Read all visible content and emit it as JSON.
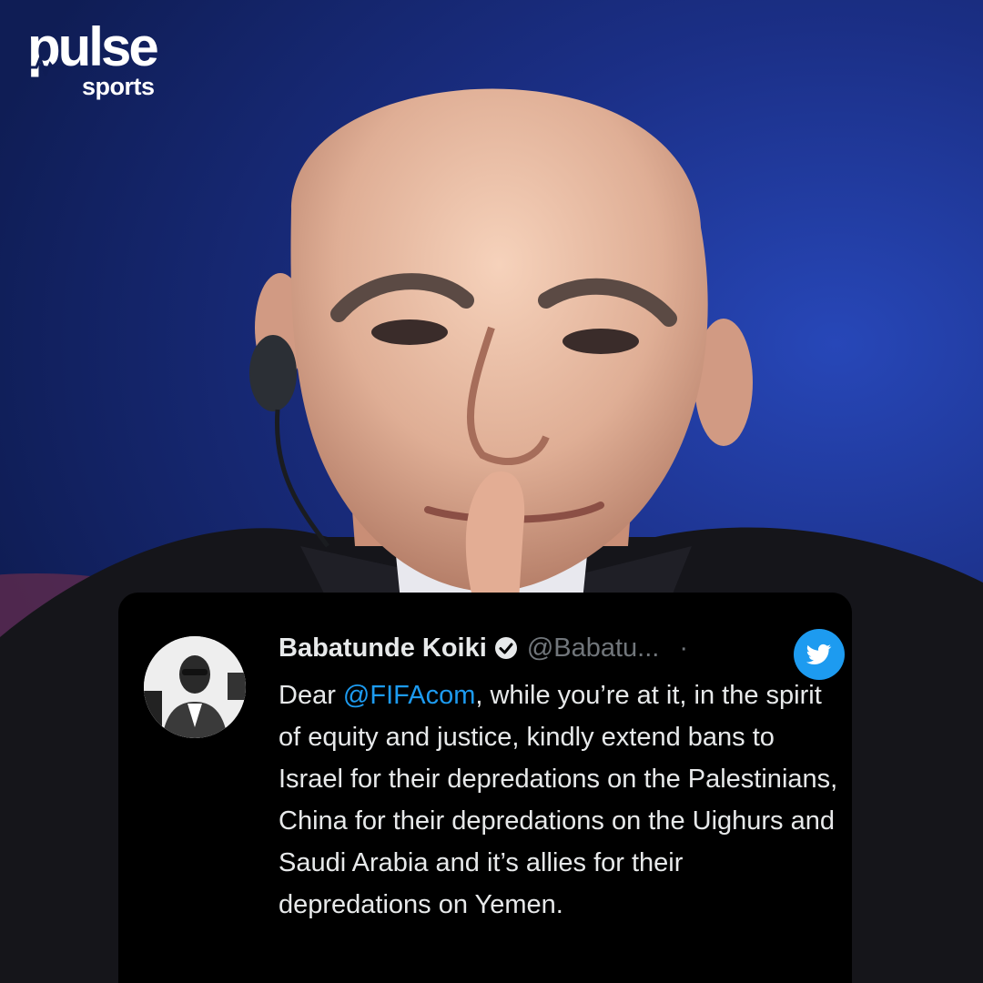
{
  "brand": {
    "name": "pulse",
    "section": "sports"
  },
  "tweet": {
    "author_name": "Babatunde Koiki",
    "handle": "@Babatu...",
    "separator": "·",
    "text_intro": "Dear ",
    "mention": "@FIFAcom",
    "text_rest": ", while you’re at it, in the spirit of equity and justice, kindly extend bans to Israel for their depredations on the Palestinians, China for their depredations on the Uighurs and Saudi Arabia and it’s allies for their depredations on Yemen."
  },
  "icons": {
    "verified": "verified-badge-icon",
    "platform": "twitter-bird-icon"
  },
  "colors": {
    "background_blue": "#1b2f86",
    "card_bg": "#000000",
    "text_primary": "#e7e9ea",
    "text_secondary": "#71767b",
    "twitter_blue": "#1d9bf0"
  }
}
